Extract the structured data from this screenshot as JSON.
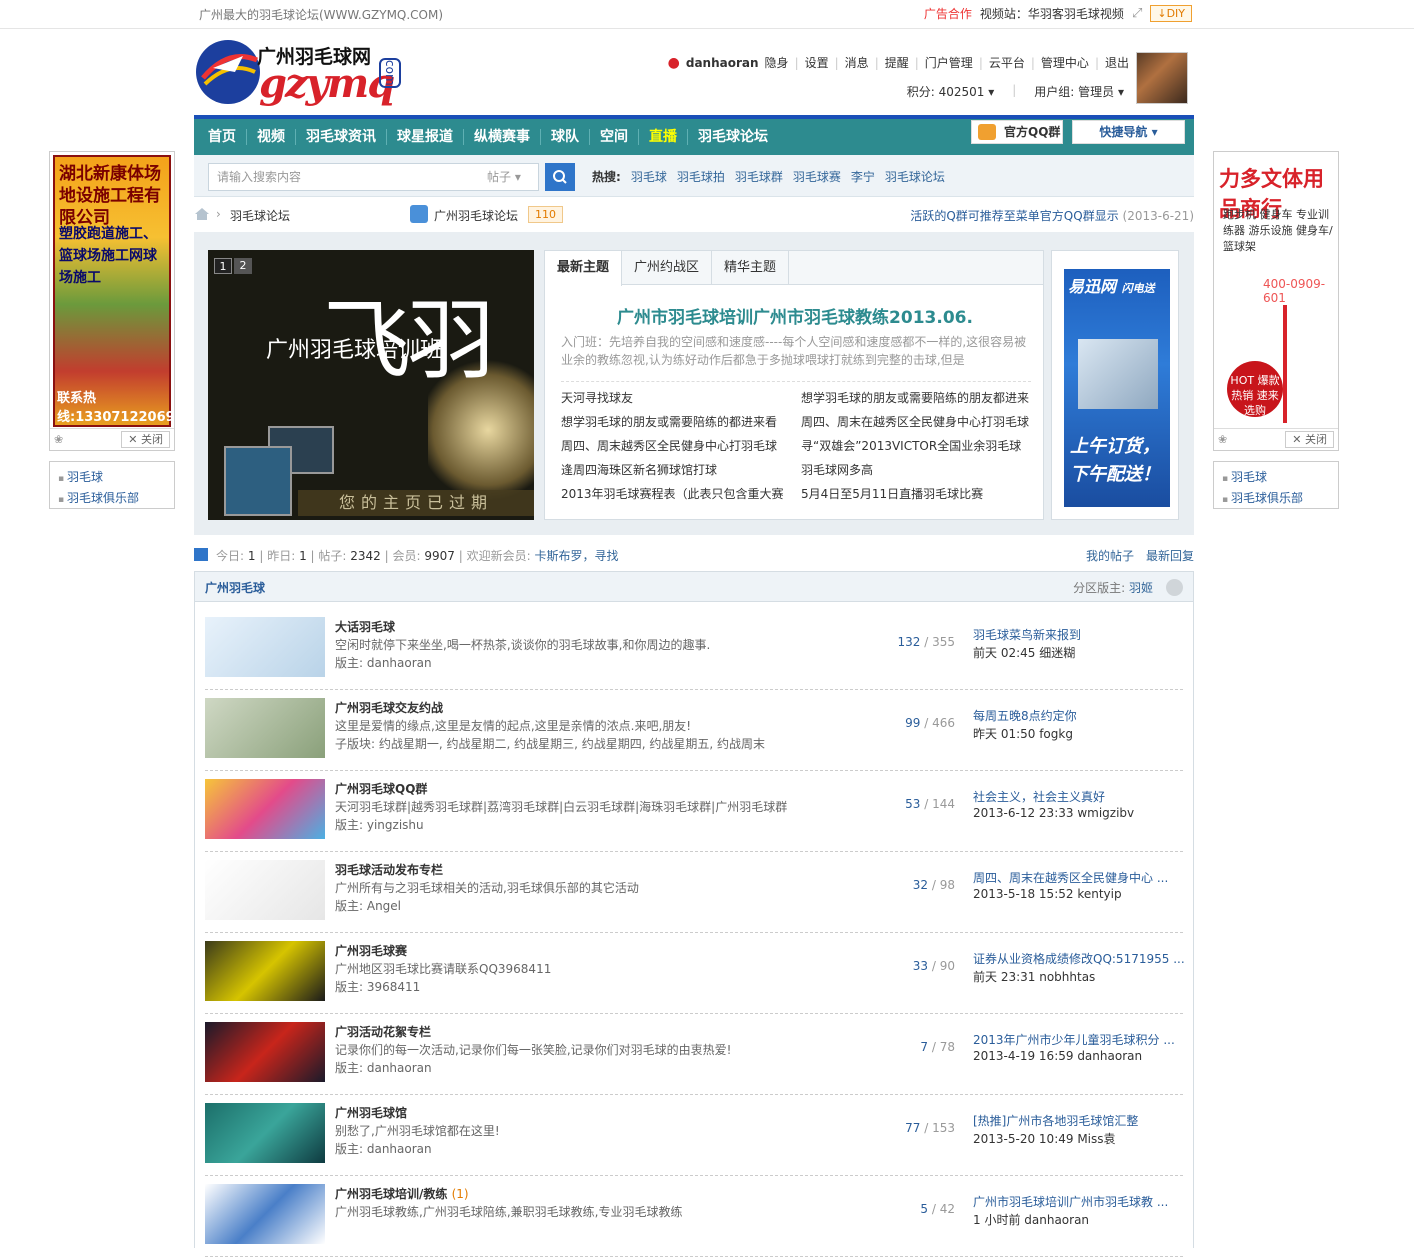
{
  "topbar": {
    "site_desc": "广州最大的羽毛球论坛(WWW.GZYMQ.COM)",
    "ad_coop": "广告合作",
    "video_site": "视频站：华羽客羽毛球视频",
    "diy": "DIY"
  },
  "logo": {
    "cn": "广州羽毛球网",
    "en": "gzymq",
    "dotcom": "com"
  },
  "user": {
    "name": "danhaoran",
    "links": [
      "隐身",
      "设置",
      "消息",
      "提醒",
      "门户管理",
      "云平台",
      "管理中心",
      "退出"
    ],
    "points": "积分: 402501",
    "group": "用户组: 管理员"
  },
  "nav": {
    "items": [
      "首页",
      "视频",
      "羽毛球资讯",
      "球星报道",
      "纵横赛事",
      "球队",
      "空间",
      "直播",
      "羽毛球论坛"
    ],
    "qq_group": "官方QQ群",
    "quick_nav": "快捷导航"
  },
  "search": {
    "placeholder": "请输入搜索内容",
    "type": "帖子",
    "hot_label": "热搜:",
    "hot": [
      "羽毛球",
      "羽毛球拍",
      "羽毛球群",
      "羽毛球赛",
      "李宁",
      "羽毛球论坛"
    ]
  },
  "breadcrumb": {
    "item1": "羽毛球论坛",
    "item2": "广州羽毛球论坛",
    "count": "110",
    "notice": "活跃的Q群可推荐至菜单官方QQ群显示",
    "notice_date": "(2013-6-21)"
  },
  "slider": {
    "nums": [
      "1",
      "2"
    ],
    "big": "飞羽",
    "caption": "广州羽毛球培训班",
    "footer": "您的主页已过期"
  },
  "tabs": {
    "labels": [
      "最新主题",
      "广州约战区",
      "精华主题"
    ],
    "headline": "广州市羽毛球培训广州市羽毛球教练2013.06.",
    "desc": "入门班：先培养自我的空间感和速度感----每个人空间感和速度感都不一样的,这很容易被业余的教练忽视,认为练好动作后都急于多抛球喂球打就练到完整的击球,但是",
    "left": [
      "天河寻找球友",
      "想学羽毛球的朋友或需要陪练的都进来看",
      "周四、周末越秀区全民健身中心打羽毛球",
      "逢周四海珠区新名狮球馆打球",
      "2013年羽毛球赛程表（此表只包含重大赛"
    ],
    "right": [
      "想学羽毛球的朋友或需要陪练的朋友都进来",
      "周四、周末在越秀区全民健身中心打羽毛球",
      "寻“双雄会”2013VICTOR全国业余羽毛球",
      "羽毛球网多高",
      "5月4日至5月11日直播羽毛球比赛"
    ]
  },
  "side_ad": {
    "brand": "易迅网",
    "sub": "闪电送",
    "slogan1": "上午订货，",
    "slogan2": "下午配送！"
  },
  "stats": {
    "today": "1",
    "yesterday": "1",
    "posts": "2342",
    "members": "9907",
    "new_member": "卡斯布罗，寻找",
    "my_posts": "我的帖子",
    "latest": "最新回复",
    "l_today": "今日:",
    "l_yest": "昨日:",
    "l_posts": "帖子:",
    "l_mem": "会员:",
    "l_welcome": "欢迎新会员:"
  },
  "forum": {
    "title": "广州羽毛球",
    "moderator_label": "分区版主:",
    "moderator": "羽姬",
    "rows": [
      {
        "name": "大话羽毛球",
        "badge": "",
        "desc": "空闲时就停下来坐坐,喝一杯热茶,谈谈你的羽毛球故事,和你周边的趣事.",
        "mod": "版主: danhaoran",
        "threads": "132",
        "posts": "355",
        "last_title": "羽毛球菜鸟新来报到",
        "last_meta": "前天 02:45 细迷糊"
      },
      {
        "name": "广州羽毛球交友约战",
        "badge": "",
        "desc": "这里是爱情的缘点,这里是友情的起点,这里是亲情的浓点.来吧,朋友!",
        "mod": "子版块: 约战星期一, 约战星期二, 约战星期三, 约战星期四, 约战星期五, 约战周末",
        "threads": "99",
        "posts": "466",
        "last_title": "每周五晚8点约定你",
        "last_meta": "昨天 01:50 fogkg"
      },
      {
        "name": "广州羽毛球QQ群",
        "badge": "",
        "desc": "天河羽毛球群|越秀羽毛球群|荔湾羽毛球群|白云羽毛球群|海珠羽毛球群|广州羽毛球群",
        "mod": "版主: yingzishu",
        "threads": "53",
        "posts": "144",
        "last_title": "社会主义，社会主义真好",
        "last_meta": "2013-6-12 23:33 wmigzibv"
      },
      {
        "name": "羽毛球活动发布专栏",
        "badge": "",
        "desc": "广州所有与之羽毛球相关的活动,羽毛球俱乐部的其它活动",
        "mod": "版主: Angel",
        "threads": "32",
        "posts": "98",
        "last_title": "周四、周末在越秀区全民健身中心 ...",
        "last_meta": "2013-5-18 15:52 kentyip"
      },
      {
        "name": "广州羽毛球赛",
        "badge": "",
        "desc": "广州地区羽毛球比赛请联系QQ3968411",
        "mod": "版主: 3968411",
        "threads": "33",
        "posts": "90",
        "last_title": "证券从业资格成绩修改QQ:5171955 ...",
        "last_meta": "前天 23:31 nobhhtas"
      },
      {
        "name": "广羽活动花絮专栏",
        "badge": "",
        "desc": "记录你们的每一次活动,记录你们每一张笑脸,记录你们对羽毛球的由衷热爱!",
        "mod": "版主: danhaoran",
        "threads": "7",
        "posts": "78",
        "last_title": "2013年广州市少年儿童羽毛球积分 ...",
        "last_meta": "2013-4-19 16:59 danhaoran"
      },
      {
        "name": "广州羽毛球馆",
        "badge": "",
        "desc": "别愁了,广州羽毛球馆都在这里!",
        "mod": "版主: danhaoran",
        "threads": "77",
        "posts": "153",
        "last_title": "[热推]广州市各地羽毛球馆汇整",
        "last_meta": "2013-5-20 10:49 Miss袁"
      },
      {
        "name": "广州羽毛球培训/教练",
        "badge": "(1)",
        "desc": "广州羽毛球教练,广州羽毛球陪练,兼职羽毛球教练,专业羽毛球教练",
        "mod": "",
        "threads": "5",
        "posts": "42",
        "last_title": "广州市羽毛球培训广州市羽毛球教 ...",
        "last_meta": "1 小时前 danhaoran"
      }
    ]
  },
  "ad_left": {
    "line1": "湖北新康体场地设施工程有限公司",
    "line2": "塑胶跑道施工、篮球场施工网球场施工",
    "phone": "联系热线:13307122069",
    "close": "关闭",
    "links": [
      "羽毛球",
      "羽毛球俱乐部"
    ]
  },
  "ad_right": {
    "title": "力多文体用品商行",
    "lines": "跑步机  健身车 专业训练器 游乐设施 健身车/篮球架",
    "phone": "400-0909-601",
    "hot": "HOT 爆款热销 速来选购",
    "close": "关闭",
    "links": [
      "羽毛球",
      "羽毛球俱乐部"
    ]
  }
}
